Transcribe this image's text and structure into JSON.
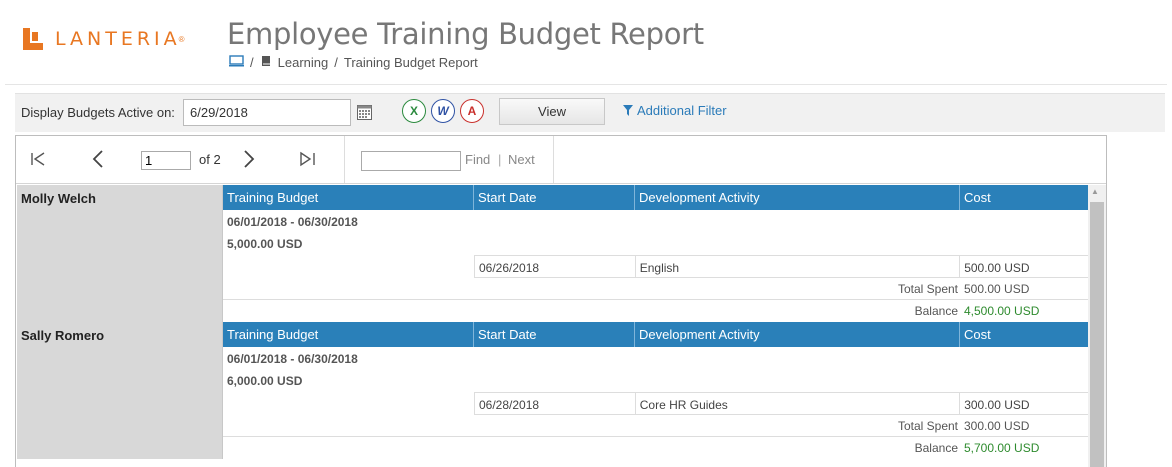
{
  "brand": {
    "name": "LANTERIA",
    "reg": "®",
    "accent": "#e87722"
  },
  "page_title": "Employee Training Budget Report",
  "breadcrumb": {
    "section": "Learning",
    "separator": "/",
    "current": "Training Budget Report"
  },
  "filter": {
    "label": "Display Budgets Active on:",
    "date_value": "6/29/2018",
    "export_excel": "X",
    "export_word": "W",
    "export_pdf": "A",
    "view_label": "View",
    "additional_filter": "Additional Filter"
  },
  "toolbar": {
    "page_value": "1",
    "of_label": "of 2",
    "find_label": "Find",
    "find_separator": "|",
    "next_label": "Next"
  },
  "columns": [
    "Training Budget",
    "Start Date",
    "Development Activity",
    "Cost"
  ],
  "employees": [
    {
      "name": "Molly Welch",
      "period": "06/01/2018 - 06/30/2018",
      "budget": "5,000.00 USD",
      "activity": {
        "start_date": "06/26/2018",
        "name": "English",
        "cost": "500.00 USD"
      },
      "total_spent_label": "Total Spent",
      "total_spent": "500.00 USD",
      "balance_label": "Balance",
      "balance": "4,500.00 USD"
    },
    {
      "name": "Sally Romero",
      "period": "06/01/2018 - 06/30/2018",
      "budget": "6,000.00 USD",
      "activity": {
        "start_date": "06/28/2018",
        "name": "Core HR Guides",
        "cost": "300.00 USD"
      },
      "total_spent_label": "Total Spent",
      "total_spent": "300.00 USD",
      "balance_label": "Balance",
      "balance": "5,700.00 USD"
    }
  ],
  "colors": {
    "header_blue": "#2a80b9",
    "balance_green": "#2e8b2e",
    "link_blue": "#2b7bb9"
  }
}
